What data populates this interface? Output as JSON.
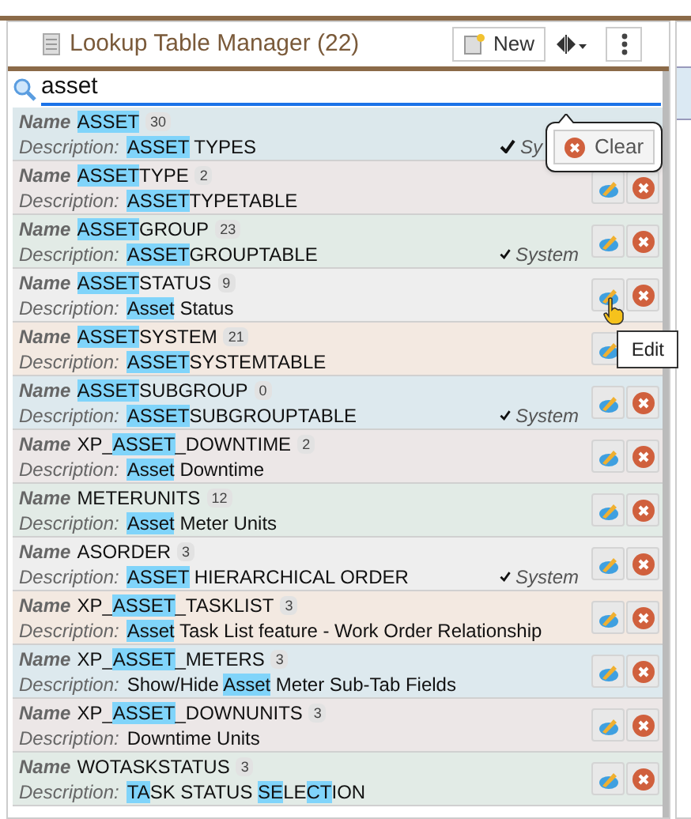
{
  "header": {
    "title": "Lookup Table Manager (22)",
    "new_button": "New"
  },
  "search": {
    "value": "asset"
  },
  "clear_popup": {
    "label": "Clear"
  },
  "rows": [
    {
      "color": "#dce8ec",
      "name_label": "Name",
      "name": [
        {
          "t": "ASSET",
          "hl": true
        }
      ],
      "count": "30",
      "desc_label": "Description:",
      "desc": [
        {
          "t": "ASSET",
          "hl": true
        },
        {
          "t": " TYPES",
          "hl": false
        }
      ],
      "system": "Sy"
    },
    {
      "color": "#ece7e7",
      "name_label": "Name",
      "name": [
        {
          "t": "ASSET",
          "hl": true
        },
        {
          "t": "TYPE",
          "hl": false
        }
      ],
      "count": "2",
      "desc_label": "Description:",
      "desc": [
        {
          "t": "ASSET",
          "hl": true
        },
        {
          "t": "TYPETABLE",
          "hl": false
        }
      ],
      "actions": [
        {
          "kind": "edit"
        },
        {
          "kind": "delete"
        }
      ]
    },
    {
      "color": "#e2ebe6",
      "name_label": "Name",
      "name": [
        {
          "t": "ASSET",
          "hl": true
        },
        {
          "t": "GROUP",
          "hl": false
        }
      ],
      "count": "23",
      "desc_label": "Description:",
      "desc": [
        {
          "t": "ASSET",
          "hl": true
        },
        {
          "t": "GROUPTABLE",
          "hl": false
        }
      ],
      "system": "System",
      "actions": [
        {
          "kind": "edit"
        },
        {
          "kind": "delete"
        }
      ]
    },
    {
      "color": "#eeeeee",
      "name_label": "Name",
      "name": [
        {
          "t": "ASSET",
          "hl": true
        },
        {
          "t": "STATUS",
          "hl": false
        }
      ],
      "count": "9",
      "desc_label": "Description:",
      "desc": [
        {
          "t": "Asset",
          "hl": true
        },
        {
          "t": " Status",
          "hl": false
        }
      ],
      "tooltip": "Edit",
      "actions": [
        {
          "kind": "edit"
        },
        {
          "kind": "delete"
        }
      ]
    },
    {
      "color": "#f3e9e1",
      "name_label": "Name",
      "name": [
        {
          "t": "ASSET",
          "hl": true
        },
        {
          "t": "SYSTEM",
          "hl": false
        }
      ],
      "count": "21",
      "desc_label": "Description:",
      "desc": [
        {
          "t": "ASSET",
          "hl": true
        },
        {
          "t": "SYSTEMTABLE",
          "hl": false
        }
      ],
      "actions": [
        {
          "kind": "edit"
        }
      ]
    },
    {
      "color": "#dde9ee",
      "name_label": "Name",
      "name": [
        {
          "t": "ASSET",
          "hl": true
        },
        {
          "t": "SUBGROUP",
          "hl": false
        }
      ],
      "count": "0",
      "desc_label": "Description:",
      "desc": [
        {
          "t": "ASSET",
          "hl": true
        },
        {
          "t": "SUBGROUPTABLE",
          "hl": false
        }
      ],
      "system": "System",
      "actions": [
        {
          "kind": "edit"
        },
        {
          "kind": "delete"
        }
      ]
    },
    {
      "color": "#ece7e7",
      "name_label": "Name",
      "name": [
        {
          "t": "XP_",
          "hl": false
        },
        {
          "t": "ASSET",
          "hl": true
        },
        {
          "t": "_DOWNTIME",
          "hl": false
        }
      ],
      "count": "2",
      "desc_label": "Description:",
      "desc": [
        {
          "t": "Asset",
          "hl": true
        },
        {
          "t": " Downtime",
          "hl": false
        }
      ],
      "actions": [
        {
          "kind": "edit"
        },
        {
          "kind": "delete"
        }
      ]
    },
    {
      "color": "#e2ebe6",
      "name_label": "Name",
      "name": [
        {
          "t": "METERUNITS",
          "hl": false
        }
      ],
      "count": "12",
      "desc_label": "Description:",
      "desc": [
        {
          "t": "Asset",
          "hl": true
        },
        {
          "t": " Meter Units",
          "hl": false
        }
      ],
      "actions": [
        {
          "kind": "edit"
        },
        {
          "kind": "delete"
        }
      ]
    },
    {
      "color": "#eeeeee",
      "name_label": "Name",
      "name": [
        {
          "t": "ASORDER",
          "hl": false
        }
      ],
      "count": "3",
      "desc_label": "Description:",
      "desc": [
        {
          "t": "ASSET",
          "hl": true
        },
        {
          "t": " HIERARCHICAL ORDER",
          "hl": false
        }
      ],
      "system": "System",
      "actions": [
        {
          "kind": "edit"
        },
        {
          "kind": "delete"
        }
      ]
    },
    {
      "color": "#f3e9e1",
      "name_label": "Name",
      "name": [
        {
          "t": "XP_",
          "hl": false
        },
        {
          "t": "ASSET",
          "hl": true
        },
        {
          "t": "_TASKLIST",
          "hl": false
        }
      ],
      "count": "3",
      "desc_label": "Description:",
      "desc": [
        {
          "t": "Asset",
          "hl": true
        },
        {
          "t": " Task List feature - Work Order Relationship",
          "hl": false
        }
      ],
      "actions": [
        {
          "kind": "edit"
        },
        {
          "kind": "delete"
        }
      ]
    },
    {
      "color": "#dde9ee",
      "name_label": "Name",
      "name": [
        {
          "t": "XP_",
          "hl": false
        },
        {
          "t": "ASSET",
          "hl": true
        },
        {
          "t": "_METERS",
          "hl": false
        }
      ],
      "count": "3",
      "desc_label": "Description:",
      "desc": [
        {
          "t": "Show/Hide ",
          "hl": false
        },
        {
          "t": "Asset",
          "hl": true
        },
        {
          "t": " Meter Sub-Tab Fields",
          "hl": false
        }
      ],
      "actions": [
        {
          "kind": "edit"
        },
        {
          "kind": "delete"
        }
      ]
    },
    {
      "color": "#ece7e7",
      "name_label": "Name",
      "name": [
        {
          "t": "XP_",
          "hl": false
        },
        {
          "t": "ASSET",
          "hl": true
        },
        {
          "t": "_DOWNUNITS",
          "hl": false
        }
      ],
      "count": "3",
      "desc_label": "Description:",
      "desc": [
        {
          "t": "Downtime Units",
          "hl": false
        }
      ],
      "actions": [
        {
          "kind": "edit"
        },
        {
          "kind": "delete"
        }
      ]
    },
    {
      "color": "#e2ebe6",
      "name_label": "Name",
      "name": [
        {
          "t": "WOTASKSTATUS",
          "hl": false
        }
      ],
      "count": "3",
      "desc_label": "Description:",
      "desc": [
        {
          "t": "TA",
          "hl": true
        },
        {
          "t": "SK STATUS ",
          "hl": false
        },
        {
          "t": "SE",
          "hl": true
        },
        {
          "t": "LE",
          "hl": false
        },
        {
          "t": "CT",
          "hl": true
        },
        {
          "t": "ION",
          "hl": false
        }
      ],
      "actions": [
        {
          "kind": "edit"
        },
        {
          "kind": "delete"
        }
      ]
    }
  ]
}
